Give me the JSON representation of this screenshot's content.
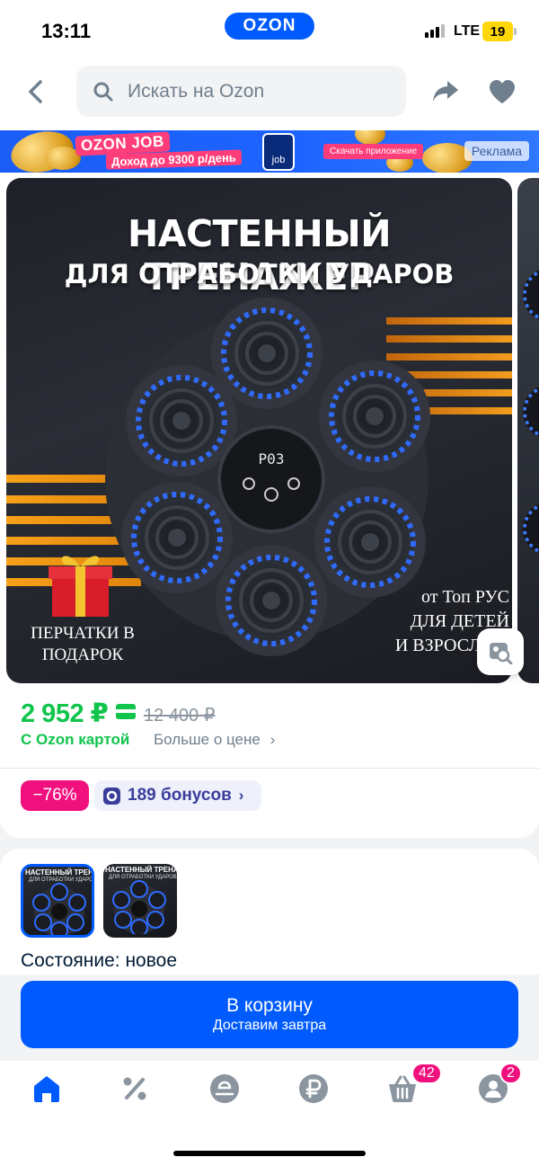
{
  "status_bar": {
    "time": "13:11",
    "brand": "OZON",
    "network": "LTE",
    "battery": "19"
  },
  "header": {
    "search_placeholder": "Искать на Ozon",
    "icons": [
      "back-icon",
      "search-icon",
      "share-icon",
      "heart-icon"
    ]
  },
  "ad_banner": {
    "logo": "OZON JOB",
    "subtitle": "Доход до 9300 р/день",
    "phone_label": "job",
    "cta": "Скачать приложение",
    "tag": "Реклама"
  },
  "product_image": {
    "title_line1": "НАСТЕННЫЙ ТРЕНАЖЕР",
    "title_line2": "ДЛЯ ОТРАБОТКИ УДАРОВ",
    "display": "P03",
    "gift_text": "ПЕРЧАТКИ В ПОДАРОК",
    "right_text": [
      "от Топ РУС",
      "ДЛЯ ДЕТЕЙ",
      "И ВЗРОСЛЫХ"
    ]
  },
  "price": {
    "current": "2 952 ₽",
    "old": "12 400 ₽",
    "card_label": "С Ozon картой",
    "more_label": "Больше о цене",
    "discount": "−76%",
    "bonus": "189 бонусов"
  },
  "variants": {
    "thumb_title": "НАСТЕННЫЙ ТРЕНАЖЕР",
    "thumb_sub": "ДЛЯ ОТРАБОТКИ УДАРОВ",
    "selected_index": 0,
    "state_label": "Состояние: новое"
  },
  "cart": {
    "title": "В корзину",
    "subtitle": "Доставим завтра"
  },
  "tabbar": {
    "items": [
      "home-icon",
      "discount-icon",
      "fresh-icon",
      "ruble-icon",
      "cart-icon",
      "profile-icon"
    ],
    "active": "home-icon",
    "cart_badge": "42",
    "profile_badge": "2"
  },
  "colors": {
    "accent": "#005bff",
    "price_green": "#10c44c",
    "discount_pink": "#f1117e"
  }
}
